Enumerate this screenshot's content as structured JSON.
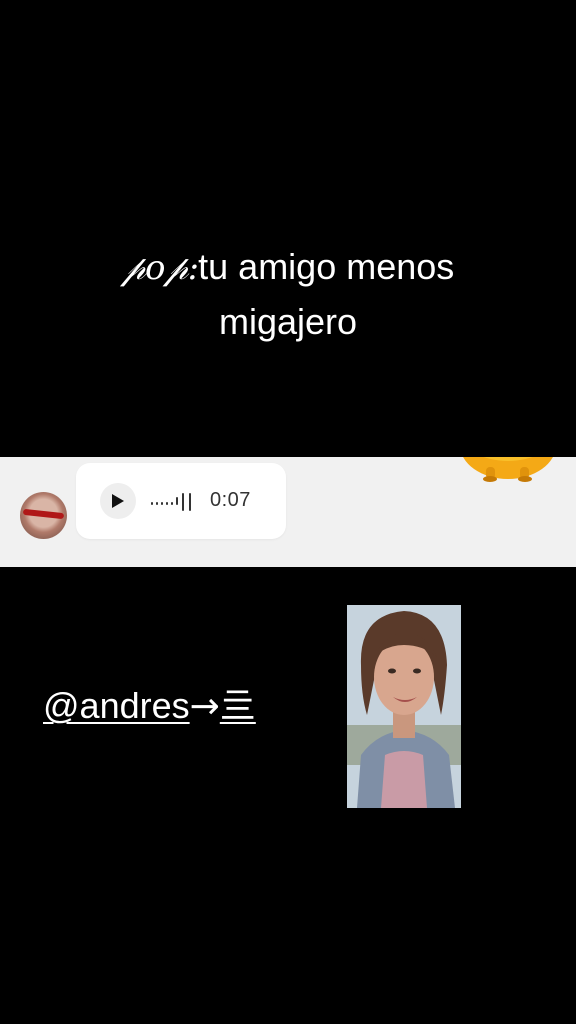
{
  "caption": {
    "prefix": "𝓅𝑜𝓅:",
    "line1": "tu amigo menos",
    "line2": "migajero"
  },
  "chat": {
    "audio_duration": "0:07"
  },
  "mention": {
    "user": "@andres",
    "arrow": "→",
    "glyph": "亖"
  },
  "icons": {
    "play": "play-icon",
    "waveform": "audio-waveform-icon",
    "mascot": "orange-mascot-icon"
  },
  "colors": {
    "background": "#000000",
    "strip": "#f1f1f1",
    "bubble": "#ffffff",
    "text": "#ffffff"
  }
}
